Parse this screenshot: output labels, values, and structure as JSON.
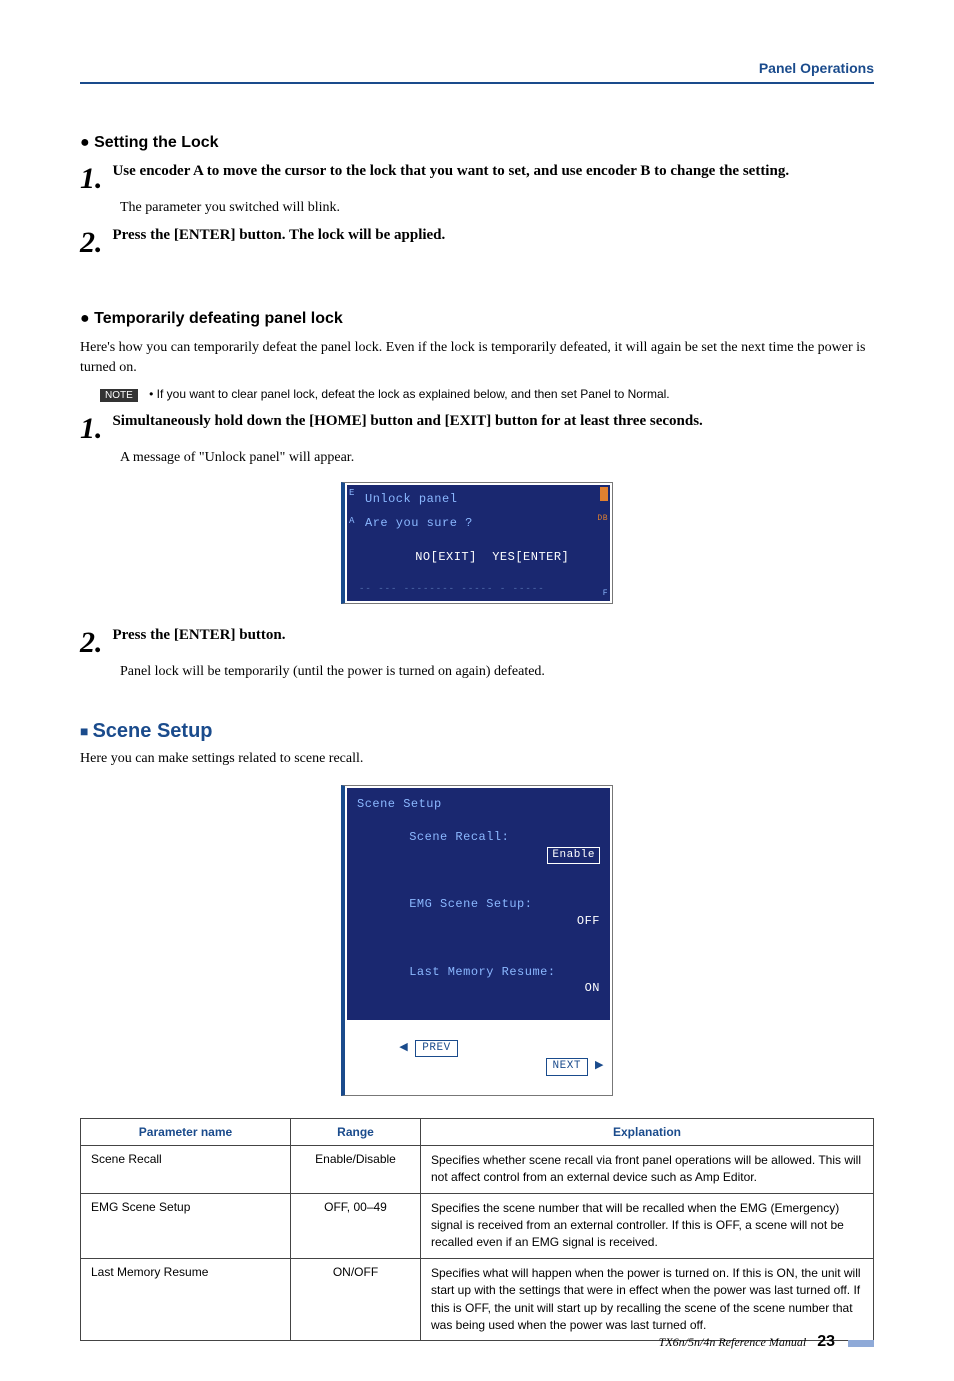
{
  "header": {
    "section": "Panel Operations"
  },
  "set_lock": {
    "heading": "Setting the Lock",
    "steps": [
      {
        "num": "1.",
        "title": "Use encoder A to move the cursor to the lock that you want to set, and use encoder B to change the setting.",
        "sub": "The parameter you switched will blink."
      },
      {
        "num": "2.",
        "title": "Press the [ENTER] button. The lock will be applied.",
        "sub": ""
      }
    ]
  },
  "temp_defeat": {
    "heading": "Temporarily defeating panel lock",
    "intro": "Here's how you can temporarily defeat the panel lock. Even if the lock is temporarily defeated, it will again be set the next time the power is turned on.",
    "note_label": "NOTE",
    "note_text": "• If you want to clear panel lock, defeat the lock as explained below, and then set Panel to Normal.",
    "steps": [
      {
        "num": "1.",
        "title": "Simultaneously hold down the [HOME] button and [EXIT] button for at least three seconds.",
        "sub": "A message of \"Unlock panel\" will appear."
      },
      {
        "num": "2.",
        "title": "Press the [ENTER] button.",
        "sub": "Panel lock will be temporarily (until the power is turned on again) defeated."
      }
    ],
    "lcd": {
      "line1": "Unlock panel",
      "line2": "Are you sure ?",
      "no": "NO[EXIT]",
      "yes": "YES[ENTER]",
      "dim": "-- --- -------- ----- - -----"
    }
  },
  "scene_setup": {
    "heading": "Scene Setup",
    "intro": "Here you can make settings related to scene recall.",
    "lcd": {
      "title": "Scene Setup",
      "rows": [
        {
          "label": "Scene Recall:",
          "value": "Enable",
          "boxed": true
        },
        {
          "label": "EMG Scene Setup:",
          "value": "OFF",
          "boxed": false
        },
        {
          "label": "Last Memory Resume:",
          "value": "ON",
          "boxed": false
        }
      ],
      "prev": "PREV",
      "next": "NEXT"
    },
    "table": {
      "headers": [
        "Parameter name",
        "Range",
        "Explanation"
      ],
      "rows": [
        {
          "name": "Scene Recall",
          "range": "Enable/Disable",
          "expl": "Specifies whether scene recall via front panel operations will be allowed. This will not affect control from an external device such as Amp Editor."
        },
        {
          "name": "EMG Scene Setup",
          "range": "OFF, 00–49",
          "expl": "Specifies the scene number that will be recalled when the EMG (Emergency) signal is received from an external controller. If this is OFF, a scene will not be recalled even if an EMG signal is received."
        },
        {
          "name": "Last Memory Resume",
          "range": "ON/OFF",
          "expl": "Specifies what will happen when the power is turned on. If this is ON, the unit will start up with the settings that were in effect when the power was last turned off. If this is OFF, the unit will start up by recalling the scene of the scene number that was being used when the power was last turned off."
        }
      ]
    }
  },
  "footer": {
    "manual": "TX6n/5n/4n  Reference Manual",
    "page": "23"
  }
}
